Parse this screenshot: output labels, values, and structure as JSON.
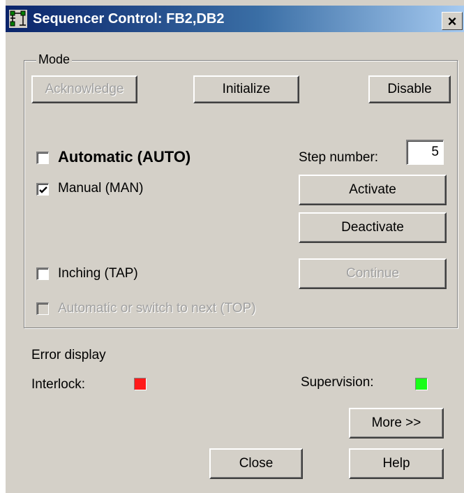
{
  "window": {
    "title": "Sequencer Control: FB2,DB2",
    "close_glyph": "×",
    "icon": "sequencer-icon"
  },
  "mode": {
    "legend": "Mode",
    "acknowledge_label": "Acknowledge",
    "initialize_label": "Initialize",
    "disable_label": "Disable",
    "automatic": {
      "label": "Automatic (AUTO)",
      "checked": false
    },
    "manual": {
      "label": "Manual (MAN)",
      "checked": true
    },
    "inching": {
      "label": "Inching (TAP)",
      "checked": false
    },
    "top": {
      "label": "Automatic or switch to next (TOP)",
      "checked": false,
      "enabled": false
    },
    "step_number_label": "Step number:",
    "step_number_value": "5",
    "activate_label": "Activate",
    "deactivate_label": "Deactivate",
    "continue_label": "Continue"
  },
  "errors": {
    "heading": "Error display",
    "interlock_label": "Interlock:",
    "interlock_color": "#ff1a1a",
    "supervision_label": "Supervision:",
    "supervision_color": "#19ff19"
  },
  "footer": {
    "more_label": "More >>",
    "close_label": "Close",
    "help_label": "Help"
  }
}
